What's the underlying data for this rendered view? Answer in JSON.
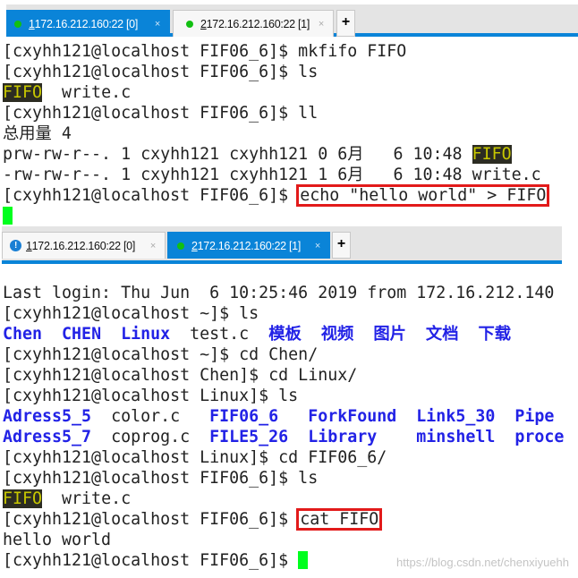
{
  "window1": {
    "tabs": [
      {
        "num": "1",
        "label": " 172.16.212.160:22 [0]",
        "status": "connected",
        "active": true
      },
      {
        "num": "2",
        "label": " 172.16.212.160:22 [1]",
        "status": "connected",
        "active": false
      }
    ],
    "close": "×",
    "new_tab": "+",
    "lines": [
      [
        {
          "t": "[cxyhh121@localhost FIF06_6]$ mkfifo FIFO",
          "c": ""
        }
      ],
      [
        {
          "t": "[cxyhh121@localhost FIF06_6]$ ls",
          "c": ""
        }
      ],
      [
        {
          "t": "FIFO",
          "c": "fifo"
        },
        {
          "t": "  write.c",
          "c": ""
        }
      ],
      [
        {
          "t": "[cxyhh121@localhost FIF06_6]$ ll",
          "c": ""
        }
      ],
      [
        {
          "t": "总用量 4",
          "c": ""
        }
      ],
      [
        {
          "t": "prw-rw-r--. 1 cxyhh121 cxyhh121 0 6月   6 10:48 ",
          "c": ""
        },
        {
          "t": "FIFO",
          "c": "fifo"
        }
      ],
      [
        {
          "t": "-rw-rw-r--. 1 cxyhh121 cxyhh121 1 6月   6 10:48 write.c",
          "c": ""
        }
      ],
      [
        {
          "t": "[cxyhh121@localhost FIF06_6]$ ",
          "c": ""
        },
        {
          "t": "echo \"hello world\" > FIFO",
          "c": "box"
        }
      ]
    ]
  },
  "window2": {
    "tabs": [
      {
        "num": "1",
        "label": " 172.16.212.160:22 [0]",
        "status": "warning",
        "active": false
      },
      {
        "num": "2",
        "label": " 172.16.212.160:22 [1]",
        "status": "connected",
        "active": true
      }
    ],
    "close": "×",
    "new_tab": "+",
    "lines": [
      [
        {
          "t": "Last login: Thu Jun  6 10:25:46 2019 from 172.16.212.140",
          "c": ""
        }
      ],
      [
        {
          "t": "[cxyhh121@localhost ~]$ ls",
          "c": ""
        }
      ],
      [
        {
          "t": "Chen",
          "c": "dir"
        },
        {
          "t": "  ",
          "c": ""
        },
        {
          "t": "CHEN",
          "c": "dir"
        },
        {
          "t": "  ",
          "c": ""
        },
        {
          "t": "Linux",
          "c": "dir"
        },
        {
          "t": "  test.c  ",
          "c": ""
        },
        {
          "t": "模板",
          "c": "dir"
        },
        {
          "t": "  ",
          "c": ""
        },
        {
          "t": "视频",
          "c": "dir"
        },
        {
          "t": "  ",
          "c": ""
        },
        {
          "t": "图片",
          "c": "dir"
        },
        {
          "t": "  ",
          "c": ""
        },
        {
          "t": "文档",
          "c": "dir"
        },
        {
          "t": "  ",
          "c": ""
        },
        {
          "t": "下载",
          "c": "dir"
        }
      ],
      [
        {
          "t": "[cxyhh121@localhost ~]$ cd Chen/",
          "c": ""
        }
      ],
      [
        {
          "t": "[cxyhh121@localhost Chen]$ cd Linux/",
          "c": ""
        }
      ],
      [
        {
          "t": "[cxyhh121@localhost Linux]$ ls",
          "c": ""
        }
      ],
      [
        {
          "t": "Adress5_5",
          "c": "dir"
        },
        {
          "t": "  color.c   ",
          "c": ""
        },
        {
          "t": "FIF06_6",
          "c": "dir"
        },
        {
          "t": "   ",
          "c": ""
        },
        {
          "t": "ForkFound",
          "c": "dir"
        },
        {
          "t": "  ",
          "c": ""
        },
        {
          "t": "Link5_30",
          "c": "dir"
        },
        {
          "t": "  ",
          "c": ""
        },
        {
          "t": "Pipe",
          "c": "dir"
        }
      ],
      [
        {
          "t": "Adress5_7",
          "c": "dir"
        },
        {
          "t": "  coprog.c  ",
          "c": ""
        },
        {
          "t": "FILE5_26",
          "c": "dir"
        },
        {
          "t": "  ",
          "c": ""
        },
        {
          "t": "Library",
          "c": "dir"
        },
        {
          "t": "    ",
          "c": ""
        },
        {
          "t": "minshell",
          "c": "dir"
        },
        {
          "t": "  ",
          "c": ""
        },
        {
          "t": "proce",
          "c": "dir"
        }
      ],
      [
        {
          "t": "[cxyhh121@localhost Linux]$ cd FIF06_6/",
          "c": ""
        }
      ],
      [
        {
          "t": "[cxyhh121@localhost FIF06_6]$ ls",
          "c": ""
        }
      ],
      [
        {
          "t": "FIFO",
          "c": "fifo"
        },
        {
          "t": "  write.c",
          "c": ""
        }
      ],
      [
        {
          "t": "[cxyhh121@localhost FIF06_6]$ ",
          "c": ""
        },
        {
          "t": "cat FIFO",
          "c": "box"
        }
      ],
      [
        {
          "t": "hello world",
          "c": ""
        }
      ],
      [
        {
          "t": "[cxyhh121@localhost FIF06_6]$ ",
          "c": ""
        }
      ]
    ]
  },
  "watermark": "https://blog.csdn.net/chenxiyuehh"
}
